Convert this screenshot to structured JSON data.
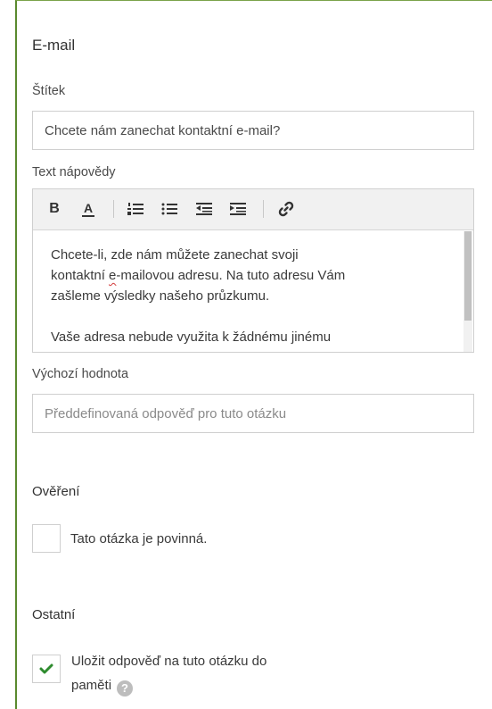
{
  "title": "E-mail",
  "label_field": {
    "label": "Štítek",
    "value": "Chcete nám zanechat kontaktní e-mail?"
  },
  "help_text": {
    "label": "Text nápovědy",
    "toolbar": [
      "bold",
      "font-color",
      "ordered-list",
      "bullet-list",
      "outdent",
      "indent",
      "link"
    ],
    "toolbar_glyphs": {
      "bold": "B",
      "font_color": "A"
    },
    "paragraph1_part1": "Chcete-li, zde nám můžete zanechat svoji",
    "paragraph1_part2a": "kontaktní ",
    "paragraph1_squiggle": "e",
    "paragraph1_part2b": "-mailovou adresu. Na tuto adresu Vám",
    "paragraph1_part3": "zašleme výsledky našeho průzkumu.",
    "paragraph2": "Vaše adresa nebude využita k žádnému jinému"
  },
  "default_value": {
    "label": "Výchozí hodnota",
    "placeholder": "Předdefinovaná odpověď pro tuto otázku"
  },
  "validation": {
    "heading": "Ověření",
    "required_label": "Tato otázka je povinná.",
    "required_checked": false
  },
  "other": {
    "heading": "Ostatní",
    "remember_label_line1": "Uložit odpověď na tuto otázku do",
    "remember_label_line2": "paměti",
    "remember_checked": true,
    "help_glyph": "?"
  },
  "colors": {
    "accent": "#5a8a2e",
    "check": "#2e8b2e"
  }
}
